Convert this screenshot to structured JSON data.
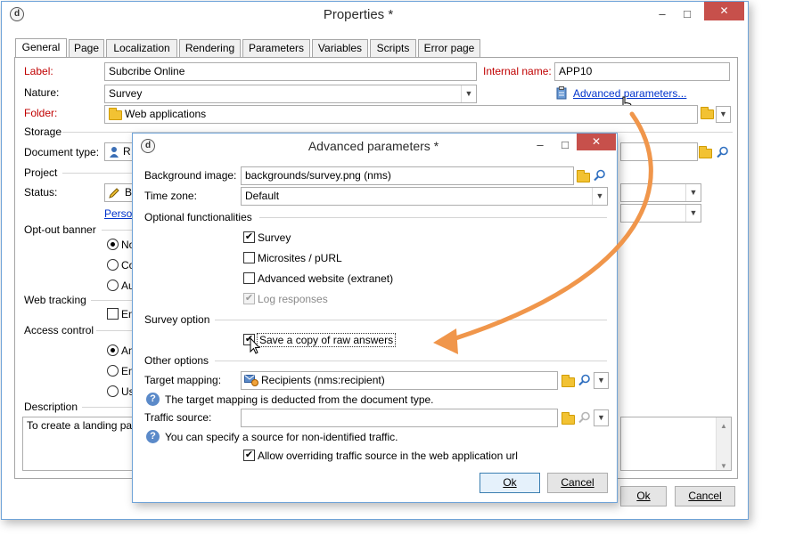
{
  "main_window": {
    "title": "Properties *",
    "minimize": "–",
    "maximize": "□",
    "close": "✕",
    "tabs": [
      "General",
      "Page",
      "Localization",
      "Rendering",
      "Parameters",
      "Variables",
      "Scripts",
      "Error page"
    ],
    "label_label": "Label:",
    "label_value": "Subcribe Online",
    "internal_name_label": "Internal name:",
    "internal_name_value": "APP10",
    "nature_label": "Nature:",
    "nature_value": "Survey",
    "advanced_link": "Advanced parameters...",
    "folder_label": "Folder:",
    "folder_value": "Web applications",
    "storage_section": "Storage",
    "document_type_label": "Document type:",
    "document_type_value": "R",
    "project_section": "Project",
    "status_label": "Status:",
    "status_value": "B",
    "personalize_link": "Perso",
    "optout_section": "Opt-out banner",
    "optout_options": [
      "No",
      "Co",
      "Au"
    ],
    "webtracking_section": "Web tracking",
    "webtracking_option": "En",
    "access_section": "Access control",
    "access_options": [
      "An",
      "En",
      "Us"
    ],
    "description_section": "Description",
    "description_value": "To create a landing pa",
    "ok_label": "Ok",
    "cancel_label": "Cancel"
  },
  "dialog": {
    "title": "Advanced parameters *",
    "minimize": "–",
    "maximize": "□",
    "close": "✕",
    "background_image_label": "Background image:",
    "background_image_value": "backgrounds/survey.png (nms)",
    "timezone_label": "Time zone:",
    "timezone_value": "Default",
    "optional_section": "Optional functionalities",
    "optional_items": [
      {
        "label": "Survey",
        "checked": true,
        "disabled": false
      },
      {
        "label": "Microsites / pURL",
        "checked": false,
        "disabled": false
      },
      {
        "label": "Advanced website (extranet)",
        "checked": false,
        "disabled": false
      },
      {
        "label": "Log responses",
        "checked": true,
        "disabled": true
      }
    ],
    "survey_section": "Survey option",
    "save_copy_label": "Save a copy of raw answers",
    "other_section": "Other options",
    "target_mapping_label": "Target mapping:",
    "target_mapping_value": "Recipients (nms:recipient)",
    "target_mapping_help": "The target mapping is deducted from the document type.",
    "traffic_source_label": "Traffic source:",
    "traffic_source_value": "",
    "traffic_source_help": "You can specify a source for non-identified traffic.",
    "allow_override_label": "Allow overriding traffic source in the web application url",
    "ok_label": "Ok",
    "cancel_label": "Cancel"
  },
  "colors": {
    "required_label": "#c00000",
    "link": "#0033cc",
    "close_button": "#c7504b",
    "arrow": "#f0964b",
    "window_border": "#6fa3d8"
  }
}
